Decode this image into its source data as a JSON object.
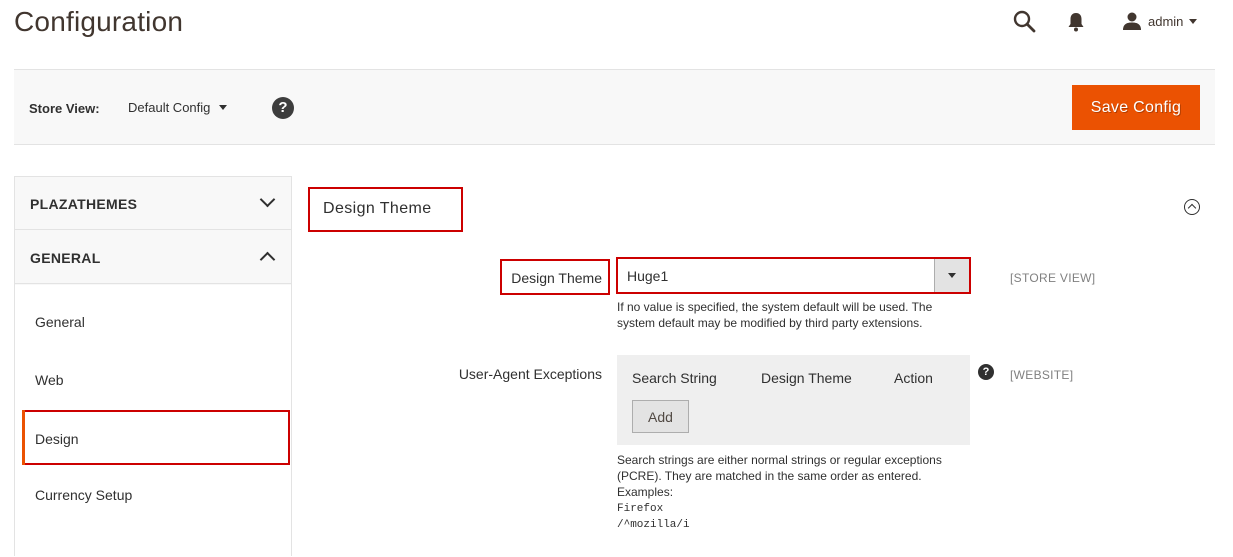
{
  "header": {
    "title": "Configuration",
    "user_name": "admin",
    "icons": {
      "search": "search-icon",
      "notifications": "bell-icon",
      "user": "user-icon"
    }
  },
  "store_bar": {
    "label": "Store View:",
    "selected": "Default Config",
    "help": "?",
    "save_label": "Save Config"
  },
  "sidebar": {
    "sections": [
      {
        "label": "PLAZATHEMES",
        "expanded": false
      },
      {
        "label": "GENERAL",
        "expanded": true
      }
    ],
    "items": [
      {
        "label": "General"
      },
      {
        "label": "Web"
      },
      {
        "label": "Design",
        "active": true
      },
      {
        "label": "Currency Setup"
      }
    ]
  },
  "main": {
    "section_title": "Design Theme",
    "theme_field": {
      "label": "Design Theme",
      "value": "Huge1",
      "scope": "[STORE VIEW]",
      "note": "If no value is specified, the system default will be used. The system default may be modified by third party extensions."
    },
    "ua_field": {
      "label": "User-Agent Exceptions",
      "columns": [
        "Search String",
        "Design Theme",
        "Action"
      ],
      "add_label": "Add",
      "help": "?",
      "scope": "[WEBSITE]",
      "note": "Search strings are either normal strings or regular exceptions (PCRE). They are matched in the same order as entered.",
      "examples_label": "Examples:",
      "examples": [
        "Firefox",
        "/^mozilla/i"
      ]
    }
  },
  "colors": {
    "accent": "#eb5202",
    "highlight": "#cc0000",
    "text": "#303030",
    "panel": "#f8f8f8"
  }
}
